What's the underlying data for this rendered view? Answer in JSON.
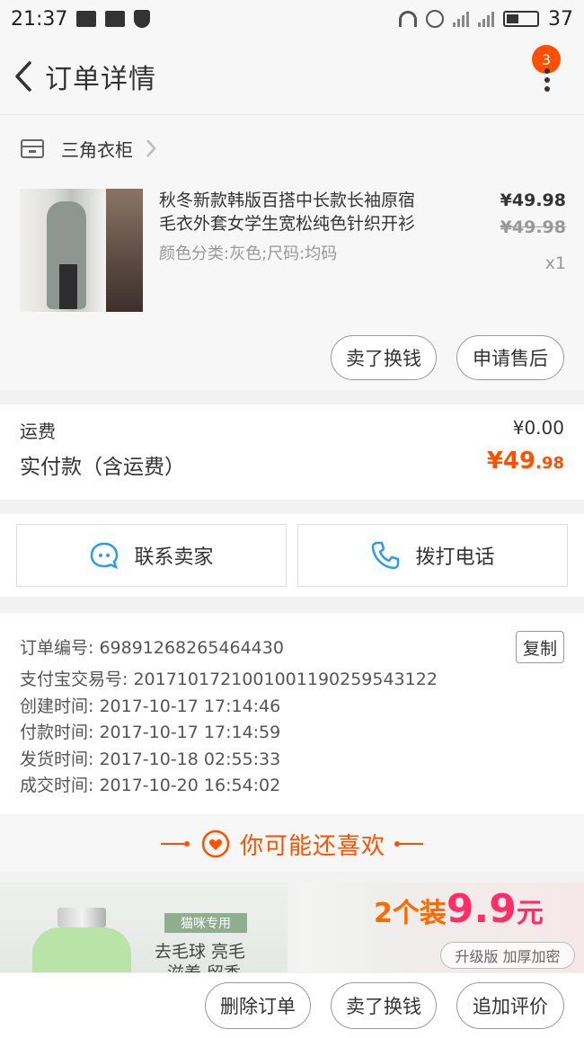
{
  "status_bar": {
    "time": "21:37",
    "battery": "37"
  },
  "nav": {
    "title": "订单详情",
    "badge": "3"
  },
  "shop": {
    "name": "三角衣柜"
  },
  "item": {
    "title_line1": "秋冬新款韩版百搭中长款长袖原宿",
    "title_line2": "毛衣外套女学生宽松纯色针织开衫",
    "spec": "颜色分类:灰色;尺码:均码",
    "price": "¥49.98",
    "original_price": "¥49.98",
    "quantity": "x1"
  },
  "item_actions": {
    "exchange": "卖了换钱",
    "after_sale": "申请售后"
  },
  "fees": {
    "shipping_label": "运费",
    "shipping_value": "¥0.00",
    "paid_label": "实付款（含运费）",
    "paid_big": "¥49",
    "paid_small": ".98"
  },
  "contact": {
    "seller": "联系卖家",
    "phone": "拨打电话"
  },
  "order_info": {
    "order_no": "订单编号: 69891268265464430",
    "copy": "复制",
    "alipay_no": "支付宝交易号: 2017101721001001190259543122",
    "created": "创建时间: 2017-10-17 17:14:46",
    "paid": "付款时间: 2017-10-17 17:14:59",
    "shipped": "发货时间: 2017-10-18 02:55:33",
    "completed": "成交时间: 2017-10-20 16:54:02"
  },
  "recommend": {
    "title": "你可能还喜欢",
    "left": {
      "tag": "猫咪专用",
      "line1": "去毛球 亮毛",
      "line2": "滋养 留香"
    },
    "right": {
      "promo_prefix": "2个装",
      "promo_num": "9.9",
      "promo_unit": "元",
      "sub": "升级版 加厚加密"
    }
  },
  "bottom_actions": {
    "delete": "删除订单",
    "exchange": "卖了换钱",
    "review": "追加评价"
  },
  "colors": {
    "accent": "#ff5000",
    "promo_pink": "#ff2e6a"
  }
}
